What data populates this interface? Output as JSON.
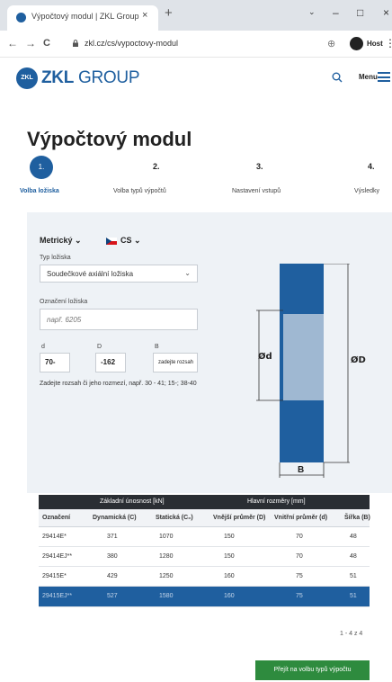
{
  "browser": {
    "tab_title": "Výpočtový modul | ZKL Group",
    "tab_close": "×",
    "new_tab": "+",
    "minimize": "–",
    "maximize": "□",
    "close": "×",
    "back": "←",
    "forward": "→",
    "reload": "C",
    "url": "zkl.cz/cs/vypoctovy-modul",
    "profile_label": "Host",
    "more": "⋮"
  },
  "header": {
    "logo_mark": "ZKL",
    "logo_bold": "ZKL",
    "logo_rest": " GROUP",
    "menu_label": "Menu"
  },
  "page": {
    "title": "Výpočtový modul"
  },
  "stepper": {
    "current_marker": "1.",
    "steps": [
      {
        "num": "1.",
        "label": "Volba ložiska"
      },
      {
        "num": "2.",
        "label": "Volba typů výpočtů"
      },
      {
        "num": "3.",
        "label": "Nastavení vstupů"
      },
      {
        "num": "4.",
        "label": "Výsledky"
      }
    ]
  },
  "form": {
    "units_selected": "Metrický",
    "lang_selected": "CS",
    "type_label": "Typ ložiska",
    "type_value": "Soudečkové axiální ložiska",
    "designation_label": "Označení ložiska",
    "designation_placeholder": "např. 6205",
    "d_label": "d",
    "D_label": "D",
    "B_label": "B",
    "d_value": "70-",
    "D_value": "-162",
    "B_value": "zadejte rozsah",
    "hint": "Zadejte rozsah či jeho rozmezí, např. 30 - 41; 15-; 38-40"
  },
  "drawing": {
    "phi_d": "Ød",
    "phi_D": "ØD",
    "B": "B"
  },
  "table": {
    "group_headers": [
      "Základní únosnost [kN]",
      "Hlavní rozměry [mm]"
    ],
    "columns": [
      "Označení",
      "Dynamická (C)",
      "Statická (C₀)",
      "Vnější průměr (D)",
      "Vnitřní průměr (d)",
      "Šířka (B)"
    ],
    "rows": [
      [
        "29414E*",
        "371",
        "1070",
        "150",
        "70",
        "48"
      ],
      [
        "29414EJ**",
        "380",
        "1280",
        "150",
        "70",
        "48"
      ],
      [
        "29415E*",
        "429",
        "1250",
        "160",
        "75",
        "51"
      ],
      [
        "29415EJ**",
        "527",
        "1580",
        "160",
        "75",
        "51"
      ]
    ],
    "selected_row": 3
  },
  "pagination": "1 - 4 z 4",
  "cta_label": "Přejít na volbu typů výpočtu",
  "colors": {
    "brand_blue": "#1f5f9f",
    "cta_green": "#2e8b3e",
    "table_header_dark": "#2a2e33"
  }
}
